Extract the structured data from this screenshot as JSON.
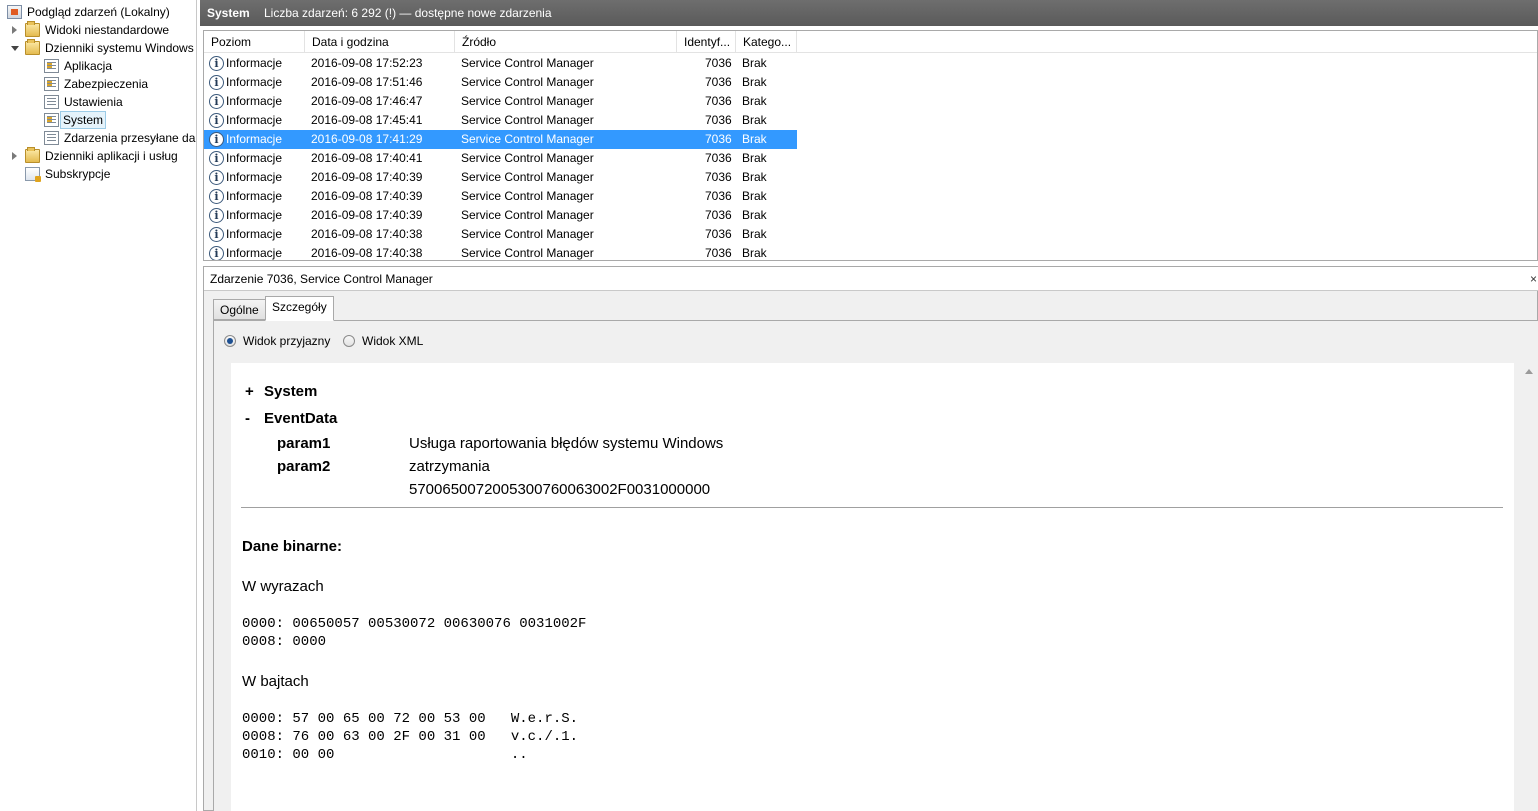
{
  "tree": {
    "items": [
      {
        "label": "Podgląd zdarzeń (Lokalny)"
      },
      {
        "label": "Widoki niestandardowe"
      },
      {
        "label": "Dzienniki systemu Windows"
      },
      {
        "label": "Aplikacja"
      },
      {
        "label": "Zabezpieczenia"
      },
      {
        "label": "Ustawienia"
      },
      {
        "label": "System"
      },
      {
        "label": "Zdarzenia przesyłane dalej"
      },
      {
        "label": "Dzienniki aplikacji i usług"
      },
      {
        "label": "Subskrypcje"
      }
    ]
  },
  "header": {
    "title": "System",
    "info": "Liczba zdarzeń: 6 292 (!) — dostępne nowe zdarzenia"
  },
  "columns": [
    "Poziom",
    "Data i godzina",
    "Źródło",
    "Identyf...",
    "Katego..."
  ],
  "events": [
    {
      "level": "Informacje",
      "datetime": "2016-09-08 17:52:23",
      "source": "Service Control Manager",
      "id": "7036",
      "category": "Brak"
    },
    {
      "level": "Informacje",
      "datetime": "2016-09-08 17:51:46",
      "source": "Service Control Manager",
      "id": "7036",
      "category": "Brak"
    },
    {
      "level": "Informacje",
      "datetime": "2016-09-08 17:46:47",
      "source": "Service Control Manager",
      "id": "7036",
      "category": "Brak"
    },
    {
      "level": "Informacje",
      "datetime": "2016-09-08 17:45:41",
      "source": "Service Control Manager",
      "id": "7036",
      "category": "Brak"
    },
    {
      "level": "Informacje",
      "datetime": "2016-09-08 17:41:29",
      "source": "Service Control Manager",
      "id": "7036",
      "category": "Brak",
      "selected": true
    },
    {
      "level": "Informacje",
      "datetime": "2016-09-08 17:40:41",
      "source": "Service Control Manager",
      "id": "7036",
      "category": "Brak"
    },
    {
      "level": "Informacje",
      "datetime": "2016-09-08 17:40:39",
      "source": "Service Control Manager",
      "id": "7036",
      "category": "Brak"
    },
    {
      "level": "Informacje",
      "datetime": "2016-09-08 17:40:39",
      "source": "Service Control Manager",
      "id": "7036",
      "category": "Brak"
    },
    {
      "level": "Informacje",
      "datetime": "2016-09-08 17:40:39",
      "source": "Service Control Manager",
      "id": "7036",
      "category": "Brak"
    },
    {
      "level": "Informacje",
      "datetime": "2016-09-08 17:40:38",
      "source": "Service Control Manager",
      "id": "7036",
      "category": "Brak"
    },
    {
      "level": "Informacje",
      "datetime": "2016-09-08 17:40:38",
      "source": "Service Control Manager",
      "id": "7036",
      "category": "Brak"
    }
  ],
  "detail": {
    "title": "Zdarzenie 7036, Service Control Manager",
    "close": "×",
    "tabs": {
      "general": "Ogólne",
      "details": "Szczegóły"
    },
    "radio": {
      "friendly": "Widok przyjazny",
      "xml": "Widok XML"
    },
    "content": {
      "system_toggle": "+",
      "system_label": "System",
      "eventdata_toggle": "-",
      "eventdata_label": "EventData",
      "param1_name": "param1",
      "param1_value": "Usługa raportowania błędów systemu Windows",
      "param2_name": "param2",
      "param2_value": "zatrzymania",
      "binary_value": "5700650072005300760063002F0031000000",
      "binary_heading": "Dane binarne:",
      "words_heading": "W wyrazach",
      "words_lines": [
        "0000: 00650057 00530072 00630076 0031002F",
        "0008: 0000"
      ],
      "bytes_heading": "W bajtach",
      "bytes_lines": [
        "0000: 57 00 65 00 72 00 53 00   W.e.r.S.",
        "0008: 76 00 63 00 2F 00 31 00   v.c./.1.",
        "0010: 00 00                     .."
      ]
    }
  },
  "colors": {
    "selection": "#3399ff",
    "header": "#5f5f5f"
  },
  "icons": {
    "event_level": "info-icon",
    "tree_root": "event-viewer-icon",
    "tree_folder": "folder-icon",
    "tree_log": "log-icon",
    "tree_subscriptions": "subscriptions-icon"
  }
}
